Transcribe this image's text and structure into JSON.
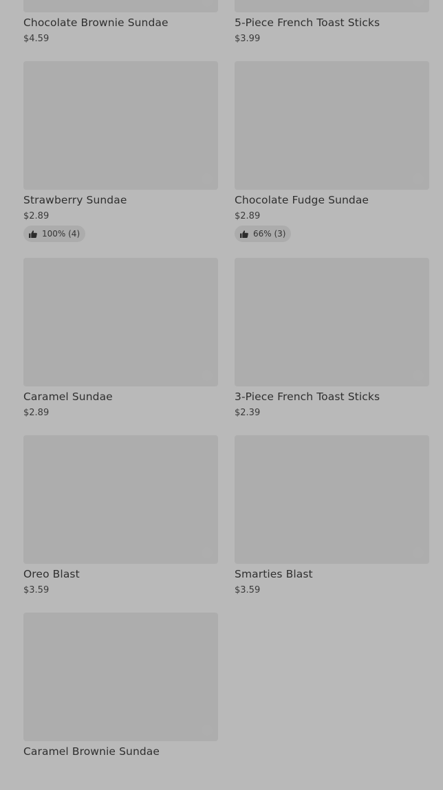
{
  "items": [
    {
      "name": "Chocolate Brownie Sundae",
      "price": "$4.59"
    },
    {
      "name": "5-Piece French Toast Sticks",
      "price": "$3.99"
    },
    {
      "name": "Strawberry Sundae",
      "price": "$2.89",
      "rating": "100% (4)"
    },
    {
      "name": "Chocolate Fudge Sundae",
      "price": "$2.89",
      "rating": "66% (3)"
    },
    {
      "name": "Caramel Sundae",
      "price": "$2.89"
    },
    {
      "name": "3-Piece French Toast Sticks",
      "price": "$2.39"
    },
    {
      "name": "Oreo Blast",
      "price": "$3.59"
    },
    {
      "name": "Smarties Blast",
      "price": "$3.59"
    },
    {
      "name": "Caramel Brownie Sundae",
      "price": ""
    }
  ]
}
